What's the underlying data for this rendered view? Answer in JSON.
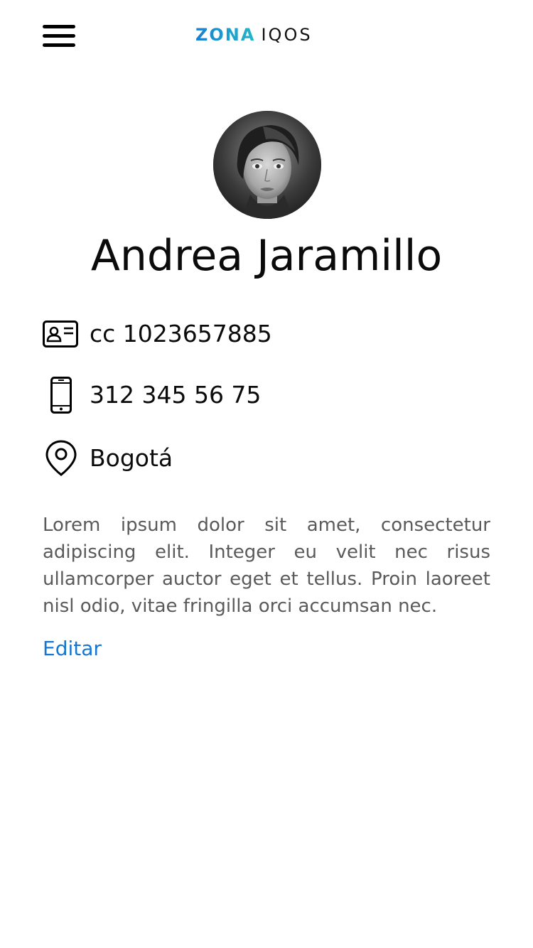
{
  "header": {
    "menu_icon": "hamburger-menu-icon",
    "logo": {
      "part1": "ZONA",
      "part2": "IQOS",
      "part1_color": "#1a7fd0",
      "part2_color": "#111111"
    }
  },
  "profile": {
    "name": "Andrea Jaramillo",
    "id_text": "cc 1023657885",
    "phone": "312 345 56 75",
    "city": "Bogotá",
    "bio": "Lorem ipsum dolor sit amet, consectetur adipiscing elit. Integer eu velit nec risus ullamcorper auctor eget et tellus. Proin laoreet nisl odio, vitae fringilla orci accumsan nec.",
    "edit_label": "Editar",
    "icons": {
      "id": "id-card-icon",
      "phone": "mobile-phone-icon",
      "city": "location-pin-icon"
    }
  },
  "colors": {
    "link": "#1677d2",
    "bio_text": "#5a5a5a",
    "text": "#0b0b0b"
  }
}
